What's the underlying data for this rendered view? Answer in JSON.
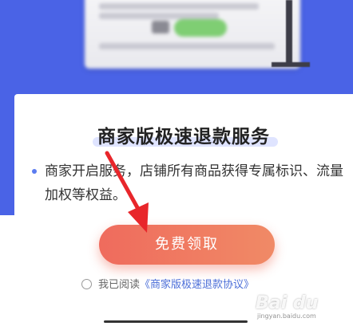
{
  "sheet": {
    "title": "商家版极速退款服务",
    "description": "商家开启服务，店铺所有商品获得专属标识、流量加权等权益。",
    "claim_button": "免费领取",
    "agreement_prefix": "我已阅读",
    "agreement_link": "《商家版极速退款协议》"
  },
  "watermark": {
    "text": "Bai du",
    "sub": "jingyan.baidu.com"
  },
  "colors": {
    "header_blue": "#4a63e6",
    "button_start": "#ef6b5d",
    "button_end": "#f08a66",
    "link_blue": "#4b6ed8",
    "annotation_red": "#e8262b"
  }
}
